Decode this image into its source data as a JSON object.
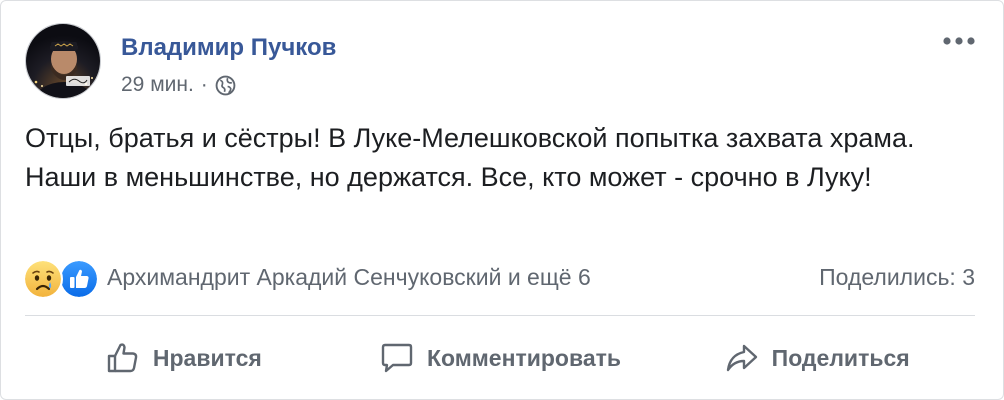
{
  "post": {
    "author": {
      "name": "Владимир Пучков",
      "avatar_icon": "profile-photo"
    },
    "meta": {
      "timestamp": "29 мин.",
      "separator": "·",
      "privacy_icon": "globe-icon"
    },
    "menu_icon": "more-horizontal-icon",
    "text": "Отцы, братья и сёстры! В Луке-Мелешковской попытка захвата храма. Наши в меньшинстве, но держатся. Все, кто может - срочно в Луку!",
    "reactions": {
      "icons": [
        "sad-reaction-icon",
        "like-reaction-icon"
      ],
      "summary": "Архимандрит Аркадий Сенчуковский и ещё 6",
      "shares": "Поделились: 3"
    },
    "actions": {
      "like_label": "Нравится",
      "comment_label": "Комментировать",
      "share_label": "Поделиться"
    },
    "colors": {
      "author_link": "#385898",
      "secondary_text": "#606770",
      "like_blue": "#1877f2",
      "sad_yellow": "#f7c94a"
    }
  }
}
